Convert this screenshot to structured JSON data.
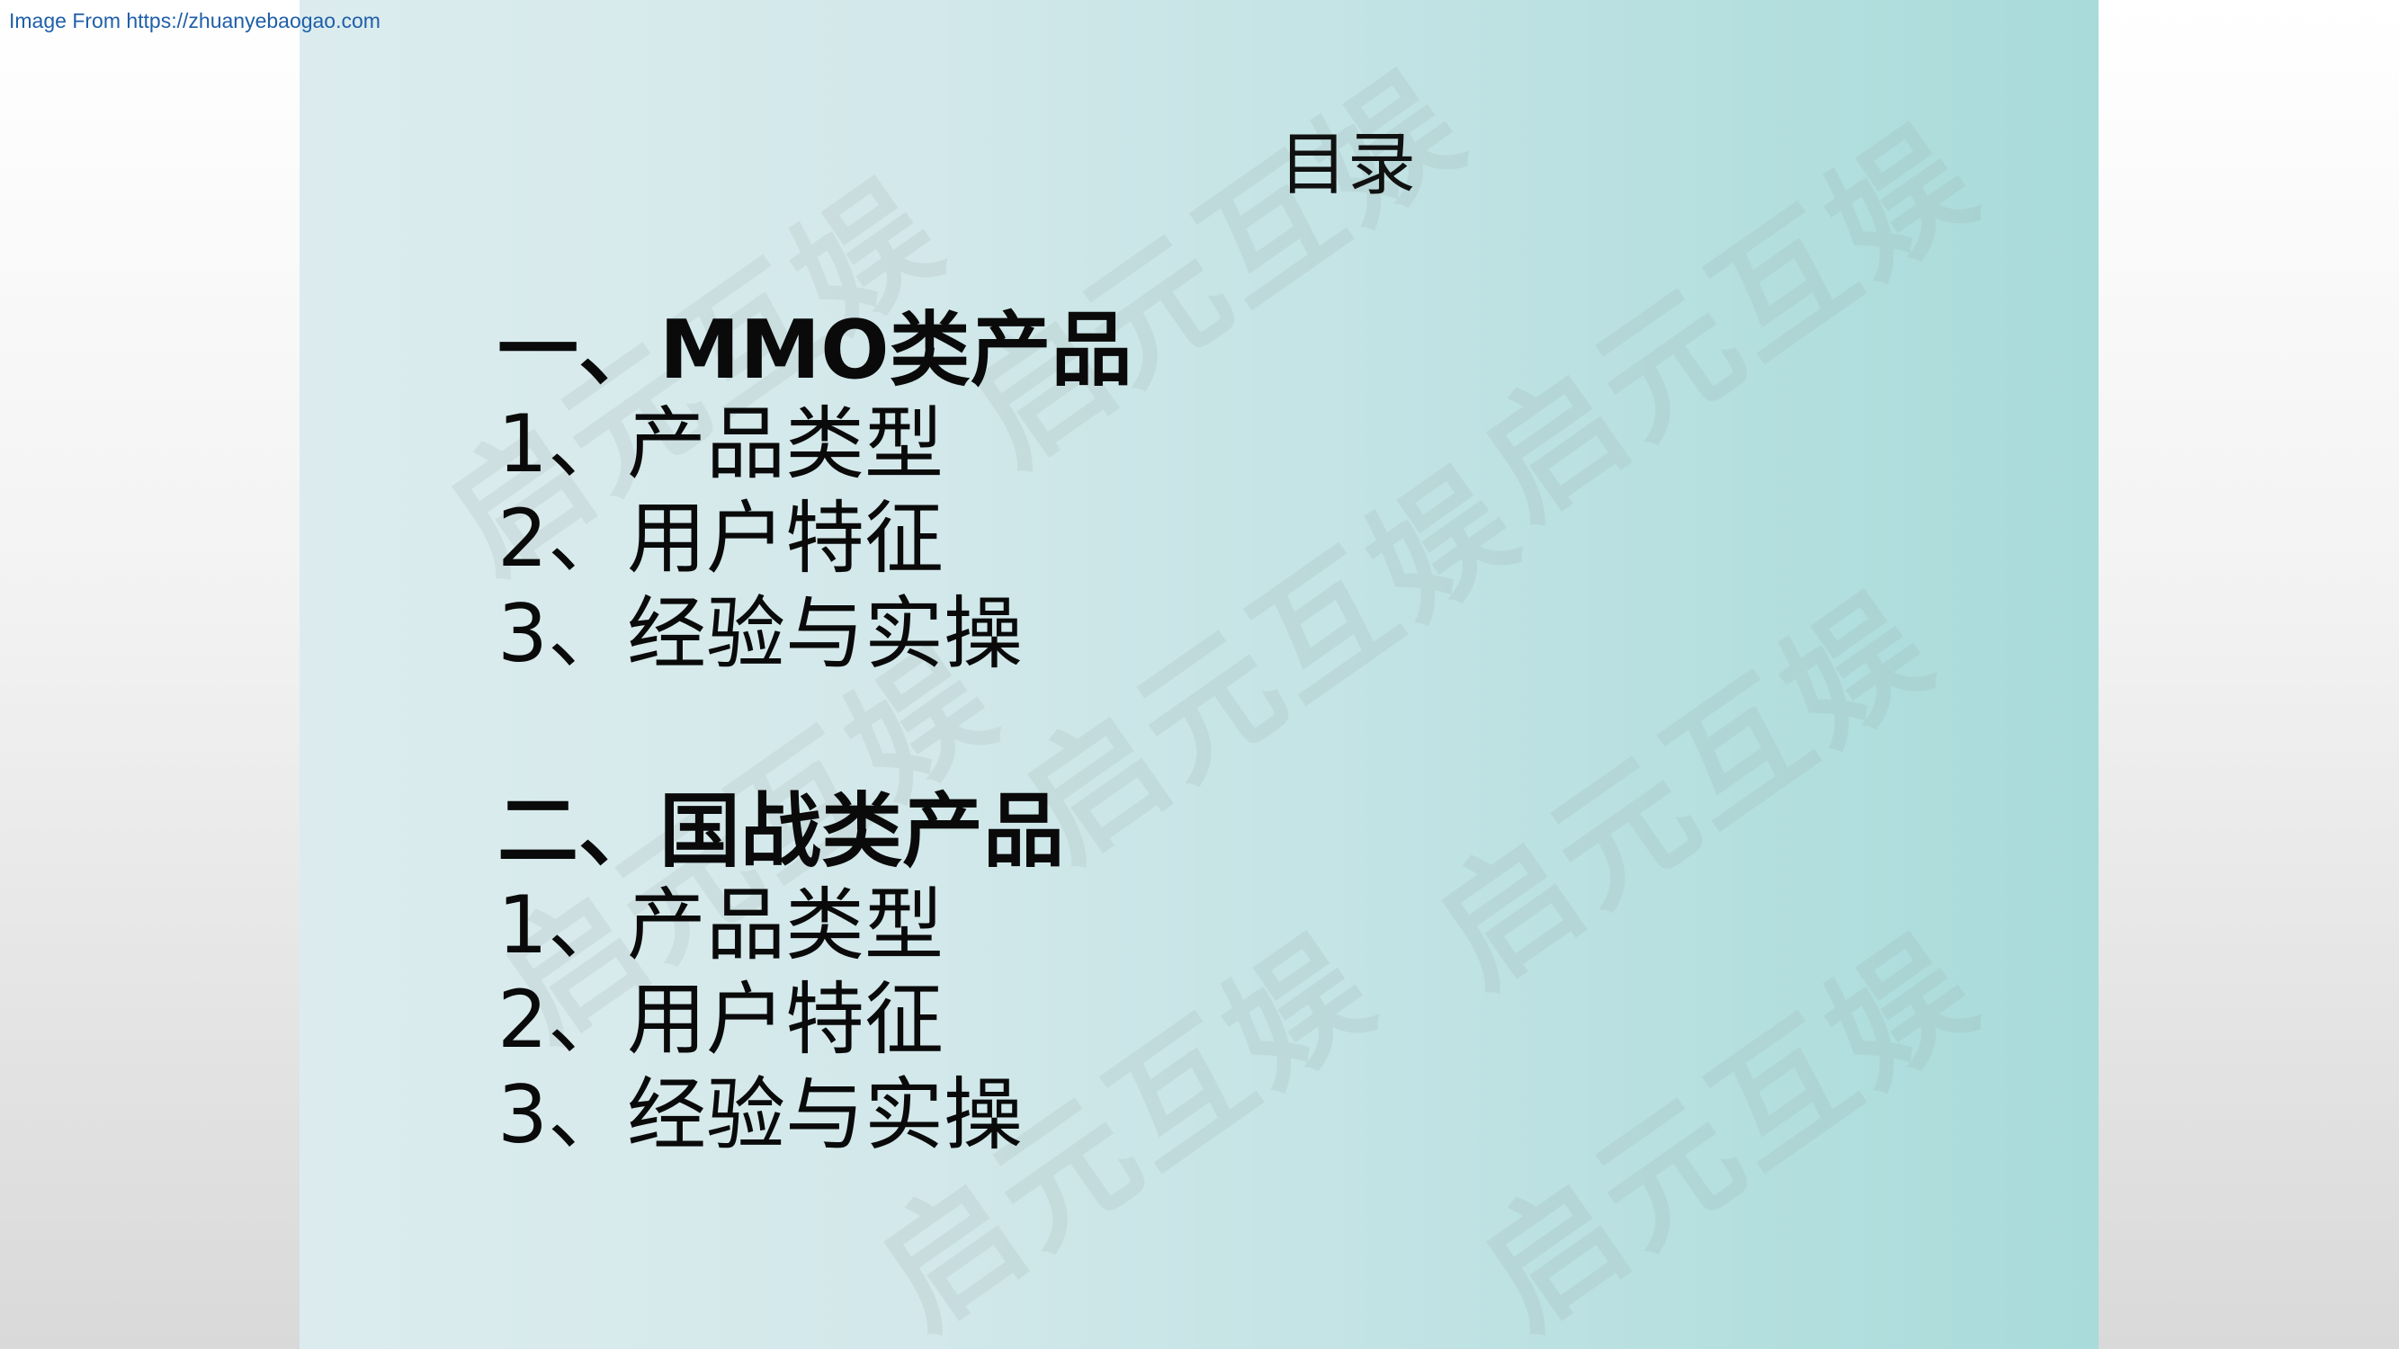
{
  "source": "Image From https://zhuanyebaogao.com",
  "watermark": "启元互娱",
  "slide": {
    "title": "目录",
    "sections": [
      {
        "heading": "一、MMO类产品",
        "items": [
          "1、产品类型",
          "2、用户特征",
          "3、经验与实操"
        ]
      },
      {
        "heading": "二、国战类产品",
        "items": [
          "1、产品类型",
          "2、用户特征",
          "3、经验与实操"
        ]
      }
    ]
  }
}
